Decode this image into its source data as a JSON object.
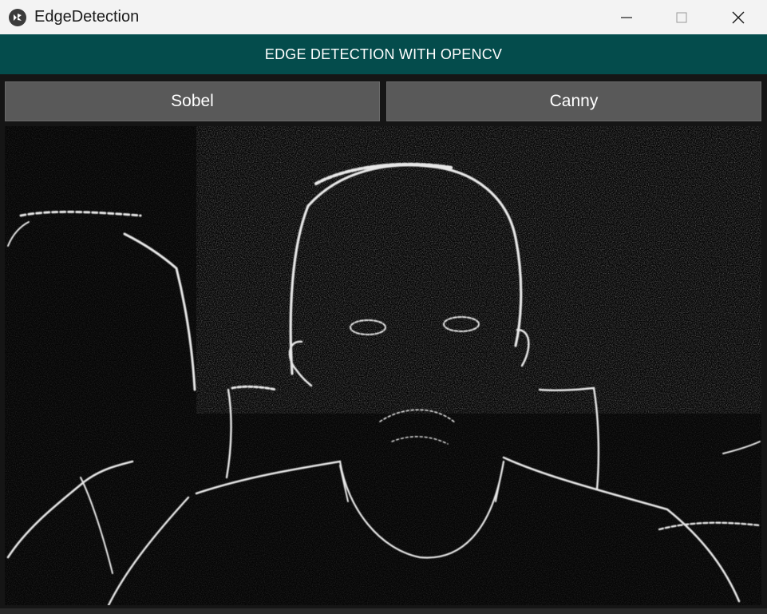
{
  "window": {
    "title": "EdgeDetection",
    "icon": "kivy-icon",
    "controls": [
      "minimize-icon",
      "maximize-icon",
      "close-icon"
    ]
  },
  "header": {
    "title": "EDGE DETECTION WITH OPENCV",
    "background": "#044c4c"
  },
  "buttons": {
    "sobel_label": "Sobel",
    "canny_label": "Canny"
  },
  "view": {
    "content": "camera-feed-edge-detection",
    "background": "#050505"
  }
}
